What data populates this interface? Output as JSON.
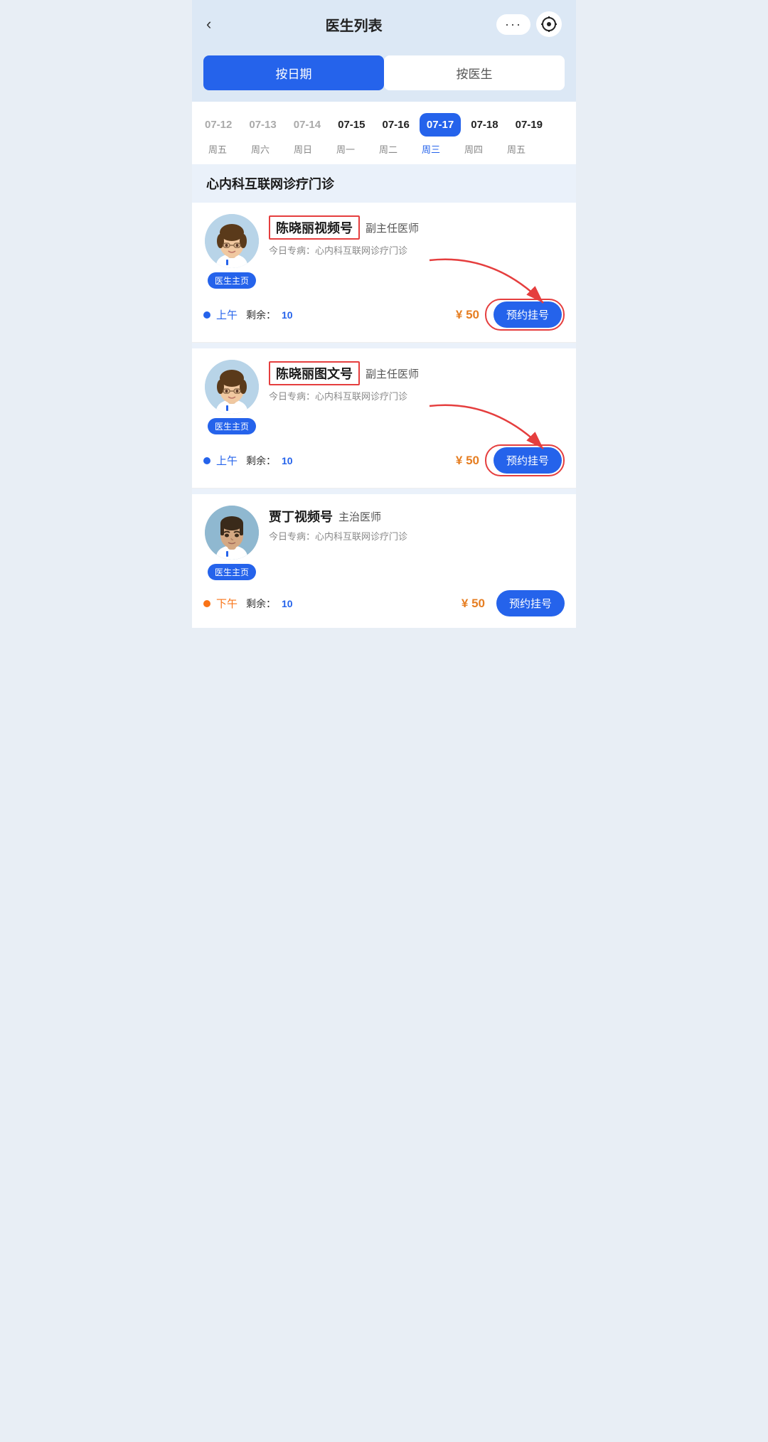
{
  "header": {
    "back_label": "‹",
    "title": "医生列表",
    "more_label": "···",
    "target_icon": "⊙"
  },
  "tabs": [
    {
      "id": "by-date",
      "label": "按日期",
      "active": true
    },
    {
      "id": "by-doctor",
      "label": "按医生",
      "active": false
    }
  ],
  "dates": [
    {
      "id": "07-12",
      "label": "07-12",
      "day": "周五",
      "dim": true,
      "bold": false,
      "selected": false
    },
    {
      "id": "07-13",
      "label": "07-13",
      "day": "周六",
      "dim": true,
      "bold": false,
      "selected": false
    },
    {
      "id": "07-14",
      "label": "07-14",
      "day": "周日",
      "dim": true,
      "bold": false,
      "selected": false
    },
    {
      "id": "07-15",
      "label": "07-15",
      "day": "周一",
      "dim": false,
      "bold": true,
      "selected": false
    },
    {
      "id": "07-16",
      "label": "07-16",
      "day": "周二",
      "dim": false,
      "bold": false,
      "selected": false
    },
    {
      "id": "07-17",
      "label": "07-17",
      "day": "周三",
      "dim": false,
      "bold": false,
      "selected": true
    },
    {
      "id": "07-18",
      "label": "07-18",
      "day": "周四",
      "dim": false,
      "bold": false,
      "selected": false
    },
    {
      "id": "07-19",
      "label": "07-19",
      "day": "周五",
      "dim": false,
      "bold": false,
      "selected": false
    }
  ],
  "section": {
    "title": "心内科互联网诊疗门诊"
  },
  "doctors": [
    {
      "id": "chen-xiaoli-video",
      "name": "陈晓丽视频号",
      "title": "副主任医师",
      "specialty_label": "今日专病：心内科互联网诊疗门诊",
      "home_btn": "医生主页",
      "gender": "female",
      "sessions": [
        {
          "period": "上午",
          "period_color": "blue",
          "remain_label": "剩余：",
          "remain": "10",
          "price": "¥ 50",
          "book_label": "预约挂号",
          "time_of_day": "morning"
        }
      ]
    },
    {
      "id": "chen-xiaoli-text",
      "name": "陈晓丽图文号",
      "title": "副主任医师",
      "specialty_label": "今日专病：心内科互联网诊疗门诊",
      "home_btn": "医生主页",
      "gender": "female",
      "sessions": [
        {
          "period": "上午",
          "period_color": "blue",
          "remain_label": "剩余：",
          "remain": "10",
          "price": "¥ 50",
          "book_label": "预约挂号",
          "time_of_day": "morning"
        }
      ]
    },
    {
      "id": "jia-ding-video",
      "name": "贾丁视频号",
      "title": "主治医师",
      "specialty_label": "今日专病：心内科互联网诊疗门诊",
      "home_btn": "医生主页",
      "gender": "male",
      "sessions": [
        {
          "period": "下午",
          "period_color": "orange",
          "remain_label": "剩余：",
          "remain": "10",
          "price": "¥ 50",
          "book_label": "预约挂号",
          "time_of_day": "afternoon"
        }
      ]
    }
  ]
}
